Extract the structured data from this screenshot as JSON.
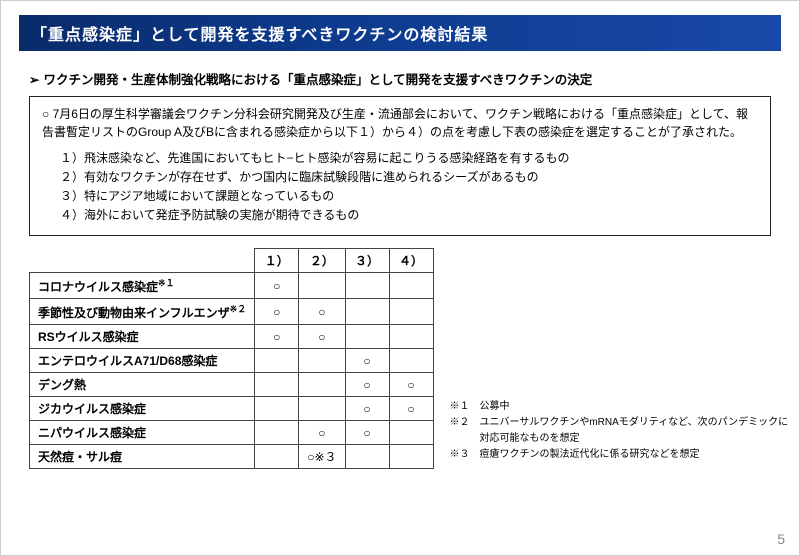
{
  "title": "「重点感染症」として開発を支援すべきワクチンの検討結果",
  "lead": "ワクチン開発・生産体制強化戦略における「重点感染症」として開発を支援すべきワクチンの決定",
  "box": {
    "intro": "○ 7月6日の厚生科学審議会ワクチン分科会研究開発及び生産・流通部会において、ワクチン戦略における「重点感染症」として、報告書暫定リストのGroup A及びBに含まれる感染症から以下１）から４）の点を考慮し下表の感染症を選定することが了承された。",
    "criteria": [
      "１）飛沫感染など、先進国においてもヒト−ヒト感染が容易に起こりうる感染経路を有するもの",
      "２）有効なワクチンが存在せず、かつ国内に臨床試験段階に進められるシーズがあるもの",
      "３）特にアジア地域において課題となっているもの",
      "４）海外において発症予防試験の実施が期待できるもの"
    ]
  },
  "table": {
    "headers": [
      "１）",
      "２）",
      "３）",
      "４）"
    ],
    "rows": [
      {
        "label": "コロナウイルス感染症",
        "sup": "※１",
        "marks": [
          "○",
          "",
          "",
          ""
        ]
      },
      {
        "label": "季節性及び動物由来インフルエンザ",
        "sup": "※２",
        "marks": [
          "○",
          "○",
          "",
          ""
        ]
      },
      {
        "label": "RSウイルス感染症",
        "sup": "",
        "marks": [
          "○",
          "○",
          "",
          ""
        ]
      },
      {
        "label": "エンテロウイルスA71/D68感染症",
        "sup": "",
        "marks": [
          "",
          "",
          "○",
          ""
        ]
      },
      {
        "label": "デング熱",
        "sup": "",
        "marks": [
          "",
          "",
          "○",
          "○"
        ]
      },
      {
        "label": "ジカウイルス感染症",
        "sup": "",
        "marks": [
          "",
          "",
          "○",
          "○"
        ]
      },
      {
        "label": "ニパウイルス感染症",
        "sup": "",
        "marks": [
          "",
          "○",
          "○",
          ""
        ]
      },
      {
        "label": "天然痘・サル痘",
        "sup": "",
        "marks": [
          "",
          "○※３",
          "",
          ""
        ]
      }
    ]
  },
  "footnotes": [
    "※１　公募中",
    "※２　ユニバーサルワクチンやmRNAモダリティなど、次のパンデミックに",
    "　　　対応可能なものを想定",
    "※３　痘瘡ワクチンの製法近代化に係る研究などを想定"
  ],
  "page": "5"
}
